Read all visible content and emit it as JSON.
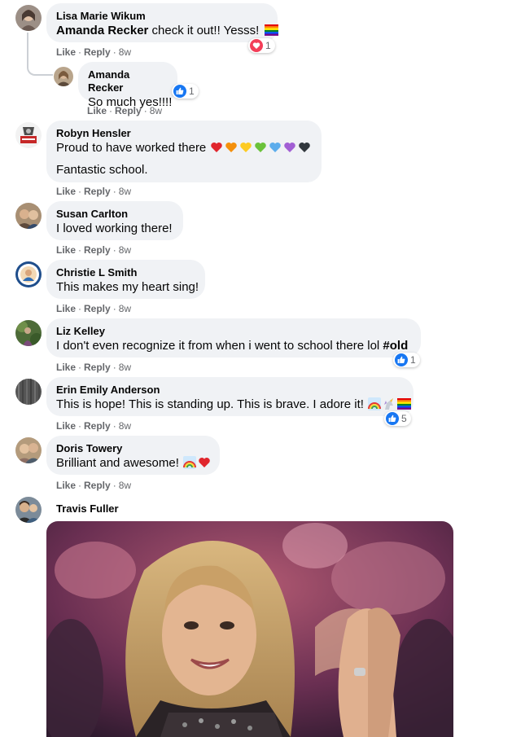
{
  "comments": [
    {
      "name": "Lisa Marie Wikum",
      "mention": "Amanda Recker",
      "text": " check it out!! Yesss!",
      "time": "8w",
      "reaction_count": "1"
    },
    {
      "name": "Amanda Recker",
      "text": "So much yes!!!!",
      "time": "8w",
      "reaction_count": "1"
    },
    {
      "name": "Robyn Hensler",
      "text": "Proud to have worked there",
      "text2": "Fantastic school.",
      "time": "8w"
    },
    {
      "name": "Susan Carlton",
      "text": "I loved working there!",
      "time": "8w"
    },
    {
      "name": "Christie L Smith",
      "text": "This makes my heart sing!",
      "time": "8w"
    },
    {
      "name": "Liz Kelley",
      "text": "I don't even recognize it from when i went to school there lol ",
      "hashtag": "#old",
      "time": "8w",
      "reaction_count": "1"
    },
    {
      "name": "Erin Emily Anderson",
      "text": "This is hope! This is standing up. This is brave. I adore it!",
      "time": "8w",
      "reaction_count": "5"
    },
    {
      "name": "Doris Towery",
      "text": "Brilliant and awesome!",
      "time": "8w"
    },
    {
      "name": "Travis Fuller",
      "time": ""
    }
  ],
  "labels": {
    "like": "Like",
    "reply": "Reply",
    "sep": "·"
  },
  "colors": {
    "like_blue": "#1877f2",
    "heart_red": "#f33e58",
    "bubble": "#f0f2f5",
    "meta": "#65676b"
  },
  "icons": {
    "reaction_love": "heart-reaction-icon",
    "reaction_like": "thumbs-up-reaction-icon",
    "gif": "clapping-woman-gif"
  }
}
